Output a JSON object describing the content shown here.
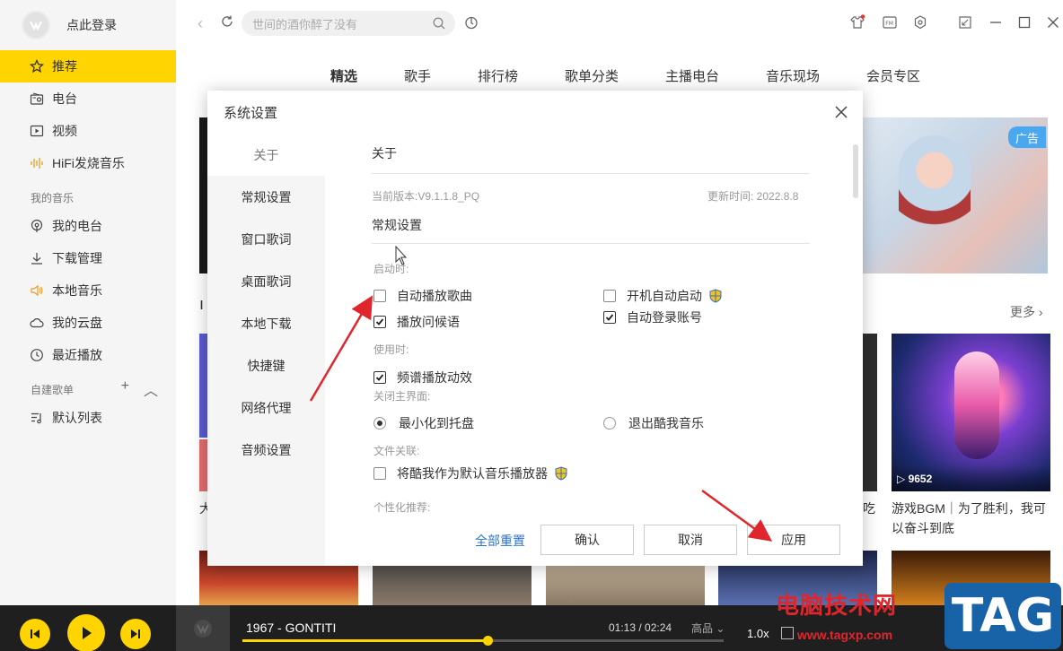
{
  "sidebar": {
    "login_text": "点此登录",
    "items": [
      {
        "label": "推荐",
        "icon": "star-icon",
        "active": true
      },
      {
        "label": "电台",
        "icon": "radio-icon"
      },
      {
        "label": "视频",
        "icon": "video-icon"
      },
      {
        "label": "HiFi发烧音乐",
        "icon": "hifi-icon"
      }
    ],
    "my_music_title": "我的音乐",
    "my_music": [
      {
        "label": "我的电台",
        "icon": "podcast-icon"
      },
      {
        "label": "下载管理",
        "icon": "download-icon"
      },
      {
        "label": "本地音乐",
        "icon": "speaker-icon"
      },
      {
        "label": "我的云盘",
        "icon": "cloud-icon"
      },
      {
        "label": "最近播放",
        "icon": "clock-icon"
      }
    ],
    "playlist_title": "自建歌单",
    "playlists": [
      {
        "label": "默认列表",
        "icon": "playlist-icon"
      }
    ]
  },
  "topbar": {
    "search_placeholder": "世间的酒你醉了没有"
  },
  "tabs": [
    "精选",
    "歌手",
    "排行榜",
    "歌单分类",
    "主播电台",
    "音乐现场",
    "会员专区"
  ],
  "content": {
    "ad_badge": "广告",
    "more": "更多",
    "card_title": "游戏BGM｜为了胜利，我可以奋斗到底",
    "play_count": "9652",
    "left_stub": "大",
    "right_stub": "吃"
  },
  "player": {
    "song": "1967 - GONTITI",
    "time": "01:13 / 02:24",
    "quality": "高品",
    "speed": "1.0x",
    "progress": 0.51
  },
  "dialog": {
    "title": "系统设置",
    "nav": [
      "关于",
      "常规设置",
      "窗口歌词",
      "桌面歌词",
      "本地下载",
      "快捷键",
      "网络代理",
      "音频设置"
    ],
    "about_heading": "关于",
    "version": "当前版本:V9.1.1.8_PQ",
    "update_time": "更新时间: 2022.8.8",
    "general_heading": "常规设置",
    "on_startup": "启动时:",
    "auto_play": "自动播放歌曲",
    "auto_play_checked": false,
    "boot_start": "开机自动启动",
    "boot_start_checked": false,
    "play_greeting": "播放问候语",
    "play_greeting_checked": true,
    "auto_login": "自动登录账号",
    "auto_login_checked": true,
    "in_use": "使用时:",
    "spectrum": "频谱播放动效",
    "spectrum_checked": true,
    "on_close": "关闭主界面:",
    "minimize_tray": "最小化到托盘",
    "exit_app": "退出酷我音乐",
    "close_choice": "minimize",
    "file_assoc": "文件关联:",
    "default_player": "将酷我作为默认音乐播放器",
    "default_player_checked": false,
    "personalized": "个性化推荐:",
    "reset_all": "全部重置",
    "confirm": "确认",
    "cancel": "取消",
    "apply": "应用"
  },
  "watermark": {
    "text": "电脑技术网",
    "url": "www.tagxp.com",
    "tag": "TAG"
  },
  "colors": {
    "accent": "#ffd400",
    "link": "#2a73c9",
    "arrow": "#e0262d"
  }
}
